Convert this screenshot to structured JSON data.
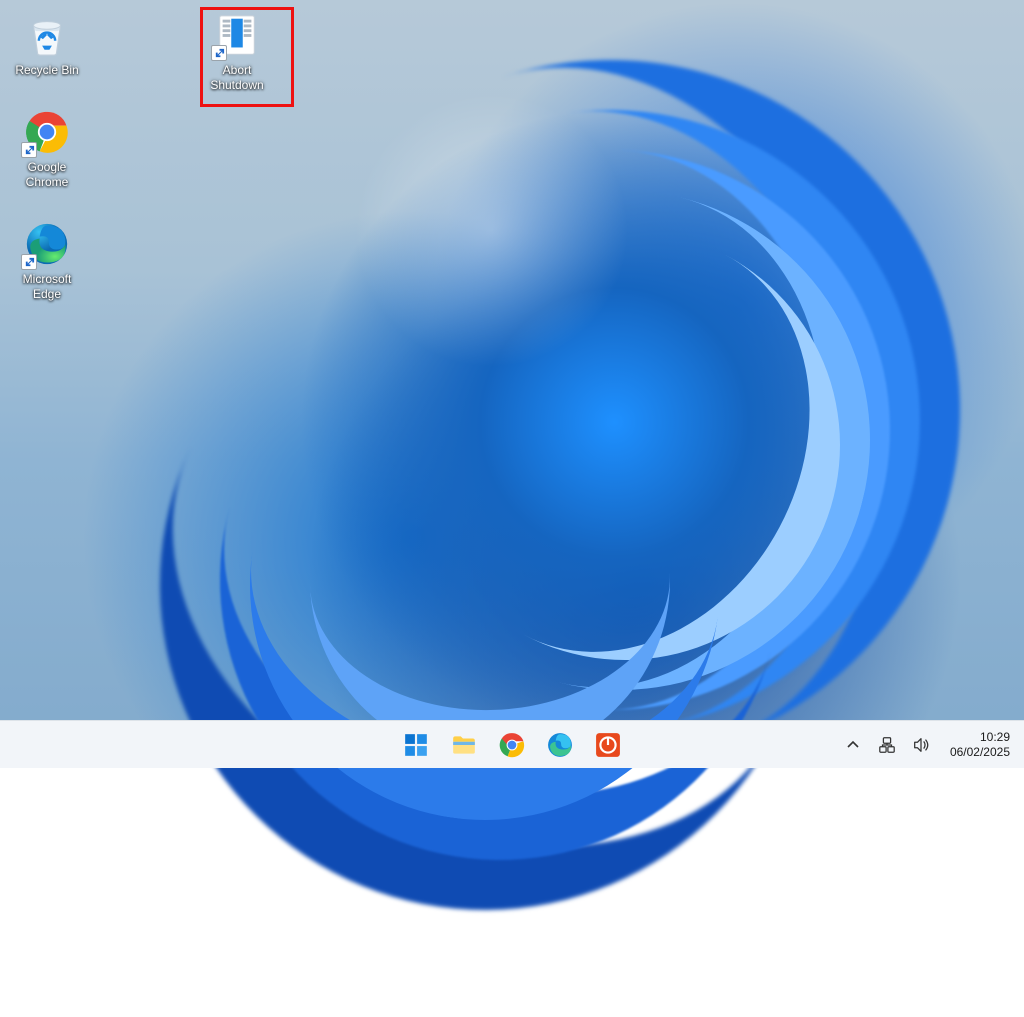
{
  "desktop": {
    "icons": [
      {
        "id": "recycle-bin",
        "label": "Recycle Bin",
        "shortcut": false
      },
      {
        "id": "google-chrome",
        "label": "Google Chrome",
        "shortcut": true
      },
      {
        "id": "microsoft-edge",
        "label": "Microsoft Edge",
        "shortcut": true
      }
    ],
    "icons_col2": [
      {
        "id": "abort-shutdown",
        "label": "Abort Shutdown",
        "shortcut": true,
        "highlighted": true
      }
    ]
  },
  "taskbar": {
    "pinned": [
      {
        "id": "start",
        "name": "start-button"
      },
      {
        "id": "file-explorer",
        "name": "file-explorer"
      },
      {
        "id": "google-chrome",
        "name": "google-chrome"
      },
      {
        "id": "microsoft-edge",
        "name": "microsoft-edge"
      },
      {
        "id": "abort-shutdown",
        "name": "abort-shutdown"
      }
    ],
    "tray": {
      "overflow": "˄",
      "network": "network",
      "volume": "volume"
    },
    "clock": {
      "time": "10:29",
      "date": "06/02/2025"
    }
  }
}
